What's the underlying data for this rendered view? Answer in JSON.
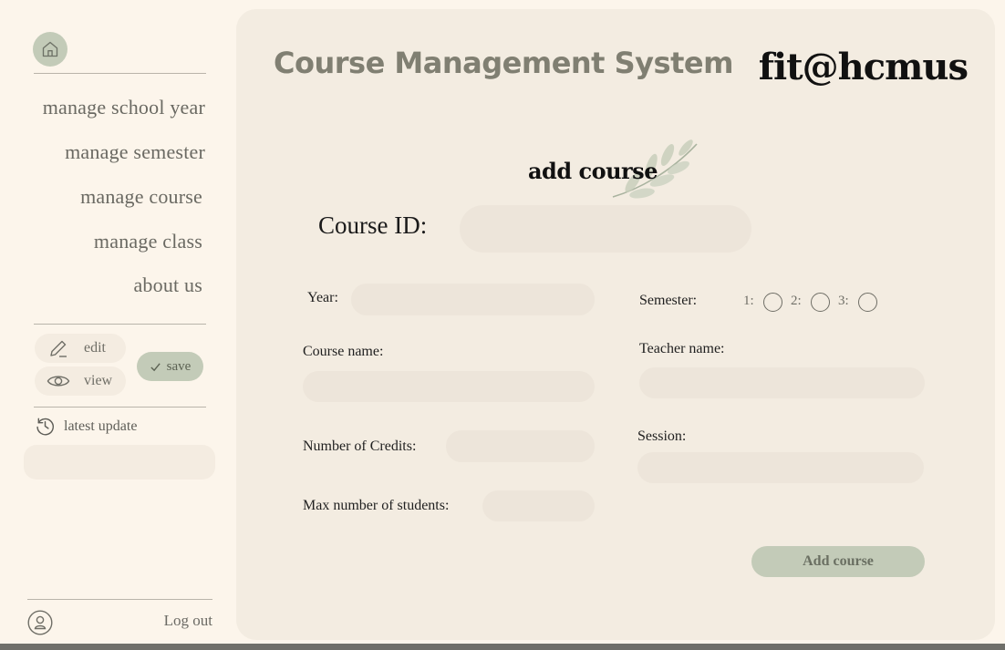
{
  "sidebar": {
    "nav": [
      {
        "label": "manage school year"
      },
      {
        "label": "manage semester"
      },
      {
        "label": "manage course"
      },
      {
        "label": "manage class"
      },
      {
        "label": "about us"
      }
    ],
    "edit_label": "edit",
    "view_label": "view",
    "save_label": "save",
    "latest_update_label": "latest update",
    "logout_label": "Log out"
  },
  "header": {
    "system_title": "Course Management System",
    "brand": "fit@hcmus"
  },
  "form": {
    "title": "add course",
    "course_id_label": "Course ID:",
    "year_label": "Year:",
    "semester_label": "Semester:",
    "semester_options": [
      "1:",
      "2:",
      "3:"
    ],
    "course_name_label": "Course name:",
    "teacher_name_label": "Teacher name:",
    "credits_label": "Number of Credits:",
    "session_label": "Session:",
    "max_students_label": "Max number of students:",
    "submit_label": "Add course"
  },
  "colors": {
    "accent": "#c3cbb8",
    "background": "#fcf5eb",
    "panel": "#f3ece1"
  }
}
